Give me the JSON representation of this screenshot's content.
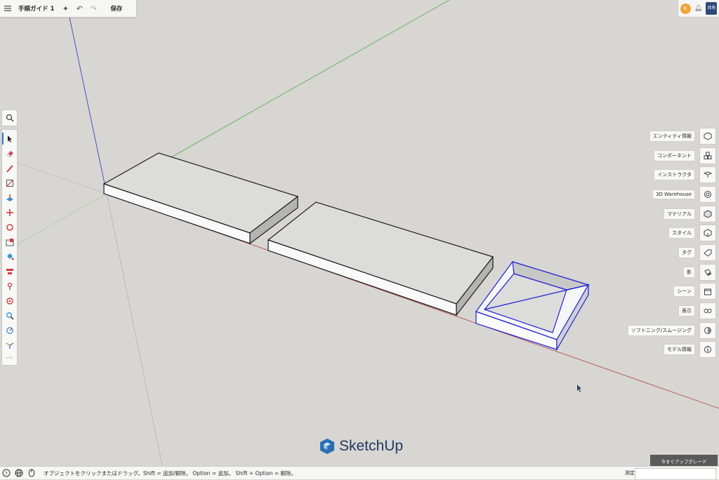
{
  "topbar": {
    "title": "手順ガイド 1",
    "save_label": "保存",
    "icons": [
      "menu-icon",
      "sparkle-icon",
      "undo-icon",
      "redo-icon"
    ]
  },
  "topright": {
    "avatar_initial": "K",
    "share_label": "共有"
  },
  "left_tools": [
    "select-tool-icon",
    "eraser-tool-icon",
    "pencil-tool-icon",
    "rectangle-tool-icon",
    "push-pull-tool-icon",
    "move-tool-icon",
    "rotate-tool-icon",
    "scale-tool-icon",
    "paint-bucket-tool-icon",
    "offset-tool-icon",
    "orbit-tool-icon",
    "position-camera-icon",
    "zoom-tool-icon",
    "tape-measure-icon",
    "axes-tool-icon"
  ],
  "right_panel": [
    {
      "label": "エンティティ情報",
      "icon": "entity-info-icon"
    },
    {
      "label": "コンポーネント",
      "icon": "components-icon"
    },
    {
      "label": "インストラクタ",
      "icon": "instructor-icon"
    },
    {
      "label": "3D Warehouse",
      "icon": "warehouse-icon"
    },
    {
      "label": "マテリアル",
      "icon": "materials-icon"
    },
    {
      "label": "スタイル",
      "icon": "styles-icon"
    },
    {
      "label": "タグ",
      "icon": "tags-icon"
    },
    {
      "label": "影",
      "icon": "shadows-icon"
    },
    {
      "label": "シーン",
      "icon": "scenes-icon"
    },
    {
      "label": "表示",
      "icon": "display-icon"
    },
    {
      "label": "ソフトニング/スムージング",
      "icon": "soften-icon"
    },
    {
      "label": "モデル情報",
      "icon": "model-info-icon"
    }
  ],
  "logo_text": "SketchUp",
  "upgrade_label": "今すぐアップグレード",
  "status": {
    "message": "オブジェクトをクリックまたはドラッグ。Shift = 追加/解除。 Option = 追加。 Shift + Option = 解除。",
    "measure_label": "測定",
    "measure_value": ""
  },
  "colors": {
    "background": "#d7d6d3",
    "red_axis": "#b8524a",
    "green_axis": "#5fb04f",
    "blue_axis": "#4d4fc2",
    "selection": "#1f1fd6",
    "brand": "#23395f"
  }
}
